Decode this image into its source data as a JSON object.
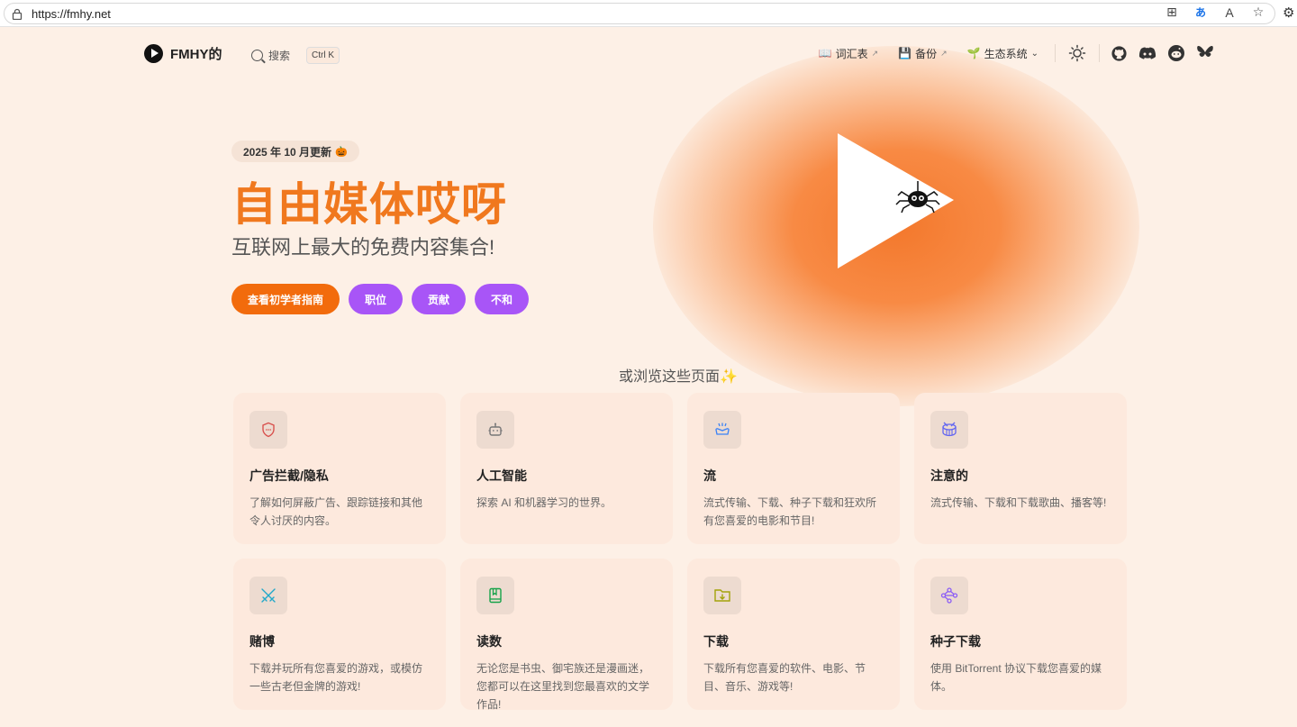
{
  "browser": {
    "url": "https://fmhy.net"
  },
  "nav": {
    "logo_text": "FMHY的",
    "search_label": "搜索",
    "search_shortcut": "Ctrl K",
    "links": [
      {
        "label": "词汇表",
        "icon": "book-icon"
      },
      {
        "label": "备份",
        "icon": "floppy-disk-icon"
      },
      {
        "label": "生态系统",
        "icon": "sprout-icon"
      }
    ]
  },
  "hero": {
    "badge": "2025 年 10 月更新",
    "title": "自由媒体哎呀",
    "subtitle": "互联网上最大的免费内容集合!",
    "buttons": [
      {
        "label": "查看初学者指南"
      },
      {
        "label": "职位"
      },
      {
        "label": "贡献"
      },
      {
        "label": "不和"
      }
    ]
  },
  "browse_heading": "或浏览这些页面✨",
  "cards": [
    {
      "title": "广告拦截/隐私",
      "desc": "了解如何屏蔽广告、跟踪链接和其他令人讨厌的内容。",
      "icon": "shield-icon",
      "color": "#d9534f"
    },
    {
      "title": "人工智能",
      "desc": "探索 AI 和机器学习的世界。",
      "icon": "robot-icon",
      "color": "#777777"
    },
    {
      "title": "流",
      "desc": "流式传输、下载、种子下载和狂欢所有您喜爱的电影和节目!",
      "icon": "tv-icon",
      "color": "#3b82f6"
    },
    {
      "title": "注意的",
      "desc": "流式传输、下载和下载歌曲、播客等!",
      "icon": "drum-icon",
      "color": "#6366f1"
    },
    {
      "title": "赌博",
      "desc": "下载并玩所有您喜爱的游戏，或模仿一些古老但金牌的游戏!",
      "icon": "swords-icon",
      "color": "#22a8c9"
    },
    {
      "title": "读数",
      "desc": "无论您是书虫、御宅族还是漫画迷，您都可以在这里找到您最喜欢的文学作品!",
      "icon": "book-open-icon",
      "color": "#16a34a"
    },
    {
      "title": "下载",
      "desc": "下载所有您喜爱的软件、电影、节目、音乐、游戏等!",
      "icon": "folder-download-icon",
      "color": "#a3a30a"
    },
    {
      "title": "种子下载",
      "desc": "使用 BitTorrent 协议下载您喜爱的媒体。",
      "icon": "network-icon",
      "color": "#8b5cf6"
    }
  ]
}
